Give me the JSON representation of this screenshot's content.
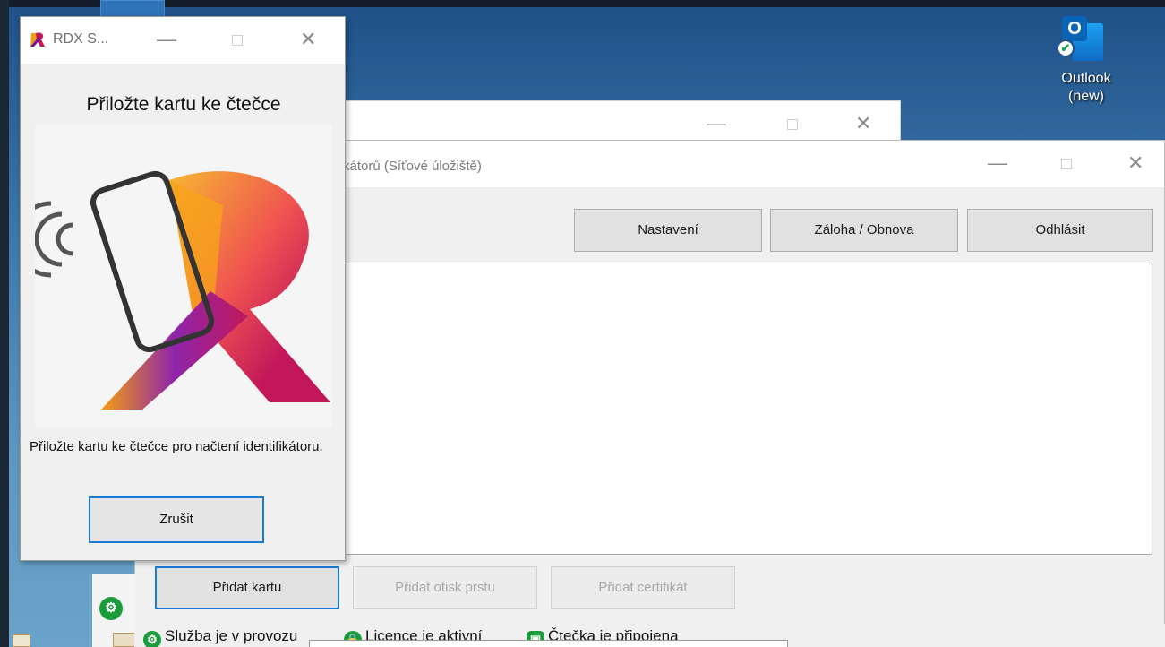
{
  "desktop": {
    "outlook_label_line1": "Outlook",
    "outlook_label_line2": "(new)"
  },
  "rdx_dialog": {
    "title": "RDX S...",
    "heading": "Přiložte kartu ke čtečce",
    "message": "Přiložte kartu ke čtečce pro načtení identifikátoru.",
    "cancel_label": "Zrušit"
  },
  "main_window": {
    "title": "kátorů (Síťové úložiště)",
    "toolbar": {
      "settings_label": "Nastavení",
      "backup_label": "Záloha / Obnova",
      "logout_label": "Odhlásit"
    },
    "actions": {
      "add_card_label": "Přidat kartu",
      "add_fingerprint_label": "Přidat otisk prstu",
      "add_certificate_label": "Přidat certifikát"
    }
  },
  "status_bar": {
    "service": "Služba je v provozu",
    "license": "Licence je aktivní",
    "reader": "Čtečka je připojena"
  },
  "icons": {
    "minimize": "—",
    "close": "✕",
    "check": "✔"
  },
  "colors": {
    "accent": "#1a7ad6",
    "status_green": "#1a9c3a",
    "logo_orange": "#f39c12",
    "logo_magenta": "#c2185b",
    "logo_purple": "#6a1b9a"
  }
}
